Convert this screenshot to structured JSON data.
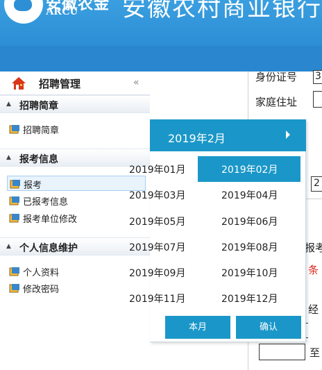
{
  "header": {
    "logo_cn": "安徽农金",
    "logo_en": "ARCU",
    "banner_title": "安徽农村商业银行员工"
  },
  "sidebar": {
    "title": "招聘管理",
    "collapse": "«",
    "groups": [
      {
        "label": "招聘简章",
        "items": [
          {
            "label": "招聘简章"
          }
        ]
      },
      {
        "label": "报考信息",
        "items": [
          {
            "label": "报考",
            "selected": true
          },
          {
            "label": "已报考信息"
          },
          {
            "label": "报考单位修改"
          }
        ]
      },
      {
        "label": "个人信息维护",
        "items": [
          {
            "label": "个人资料"
          },
          {
            "label": "修改密码"
          }
        ]
      }
    ]
  },
  "form": {
    "id_label": "身份证号",
    "id_value": "3",
    "address_label": "家庭住址",
    "field_value": "2",
    "apply_fragment": "报考",
    "condition_fragment": "条",
    "experience_fragment": "经",
    "to_label": "至"
  },
  "picker": {
    "title": "2019年2月",
    "months": [
      "2019年01月",
      "2019年02月",
      "2019年03月",
      "2019年04月",
      "2019年05月",
      "2019年06月",
      "2019年07月",
      "2019年08月",
      "2019年09月",
      "2019年10月",
      "2019年11月",
      "2019年12月"
    ],
    "selected_index": 1,
    "this_month": "本月",
    "confirm": "确认"
  },
  "colors": {
    "accent": "#1a97c8",
    "banner": "#2d8fd6",
    "condition_red": "#d9261c"
  }
}
